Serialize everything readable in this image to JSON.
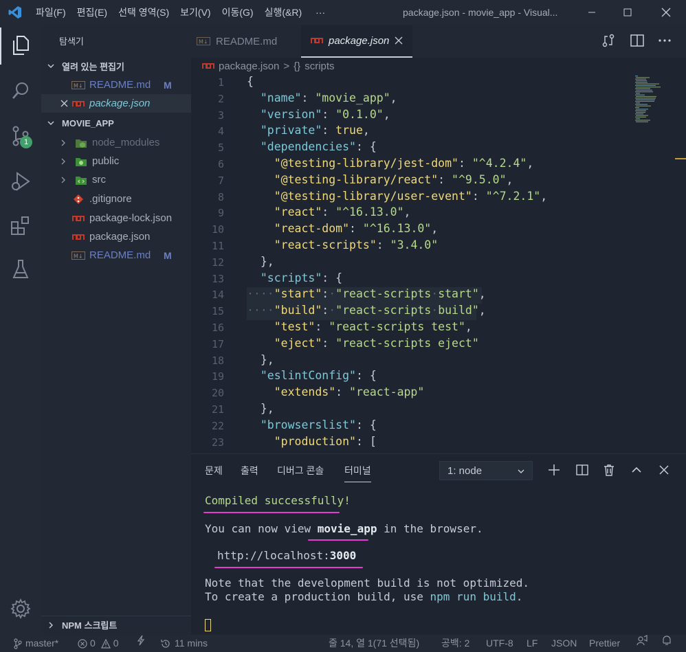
{
  "titlebar": {
    "menu": [
      "파일(F)",
      "편집(E)",
      "선택 영역(S)",
      "보기(V)",
      "이동(G)",
      "실행(&R)",
      "···"
    ],
    "title": "package.json - movie_app - Visual..."
  },
  "activity": {
    "scm_badge": "1"
  },
  "sidebar": {
    "title": "탐색기",
    "open_editors_label": "열려 있는 편집기",
    "open_editors": [
      {
        "name": "README.md",
        "status": "M",
        "icon": "markdown-icon"
      },
      {
        "name": "package.json",
        "status": "",
        "icon": "npm-icon"
      }
    ],
    "project_label": "MOVIE_APP",
    "tree": [
      {
        "name": "node_modules",
        "type": "folder"
      },
      {
        "name": "public",
        "type": "folder"
      },
      {
        "name": "src",
        "type": "folder"
      },
      {
        "name": ".gitignore",
        "type": "file"
      },
      {
        "name": "package-lock.json",
        "type": "file"
      },
      {
        "name": "package.json",
        "type": "file"
      },
      {
        "name": "README.md",
        "type": "file",
        "status": "M"
      }
    ],
    "npm_scripts_label": "NPM 스크립트"
  },
  "tabs": [
    {
      "label": "README.md",
      "active": false
    },
    {
      "label": "package.json",
      "active": true
    }
  ],
  "breadcrumb": {
    "file": "package.json",
    "separator": ">",
    "symbol_icon": "{}",
    "symbol": "scripts"
  },
  "editor": {
    "line_numbers": [
      "1",
      "2",
      "3",
      "4",
      "5",
      "6",
      "7",
      "8",
      "9",
      "10",
      "11",
      "12",
      "13",
      "14",
      "15",
      "16",
      "17",
      "18",
      "19",
      "20",
      "21",
      "22",
      "23"
    ]
  },
  "panel": {
    "tabs": [
      "문제",
      "출력",
      "디버그 콘솔",
      "터미널"
    ],
    "active_tab": "터미널",
    "terminal_select": "1: node",
    "output": {
      "compiled": "Compiled successfully!",
      "view_pre": "You can now view ",
      "view_app": "movie_app",
      "view_post": " in the browser.",
      "url_pre": "http://localhost:",
      "url_port": "3000",
      "note1": "Note that the development build is not optimized.",
      "note2_pre": "To create a production build, use ",
      "note2_cmd": "npm run build",
      "note2_post": "."
    }
  },
  "statusbar": {
    "branch": "master*",
    "errors": "0",
    "warnings": "0",
    "time": "11 mins",
    "position": "줄 14, 열 1(71 선택됨)",
    "spaces": "공백: 2",
    "encoding": "UTF-8",
    "eol": "LF",
    "language": "JSON",
    "formatter": "Prettier"
  },
  "colors": {
    "accent_pink": "#e23ed2",
    "badge_green": "#42a06a",
    "string_green": "#b7d98a",
    "key_cyan": "#7ec8d8"
  }
}
